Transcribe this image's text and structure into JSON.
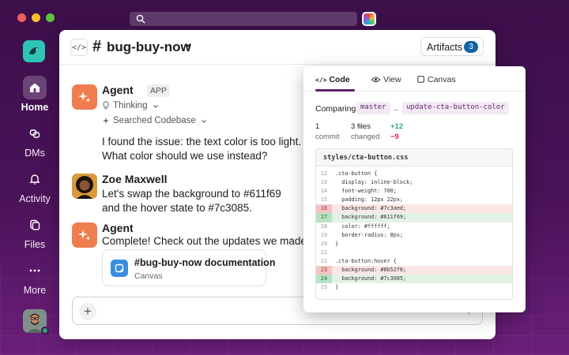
{
  "window": {
    "rail": {
      "items": [
        {
          "label": "Home",
          "icon": "home-icon",
          "active": true
        },
        {
          "label": "DMs",
          "icon": "dms-icon",
          "active": false
        },
        {
          "label": "Activity",
          "icon": "bell-icon",
          "active": false
        },
        {
          "label": "Files",
          "icon": "files-icon",
          "active": false
        },
        {
          "label": "More",
          "icon": "more-icon",
          "active": false
        }
      ]
    }
  },
  "channel": {
    "hash": "#",
    "name": "bug-buy-now",
    "artifacts_label": "Artifacts",
    "artifacts_count": "3"
  },
  "messages": {
    "agent1": {
      "name": "Agent",
      "badge": "APP",
      "thinking": "Thinking",
      "searched": "Searched Codebase",
      "line1": "I found the issue: the text color is too light.",
      "line2": "What color should we use instead?"
    },
    "zoe": {
      "name": "Zoe Maxwell",
      "line1": "Let's swap the background to #611f69",
      "line2": "and the hover state to #7c3085."
    },
    "agent2": {
      "name": "Agent",
      "line1": "Complete! Check out the updates we made:",
      "canvas_title": "#bug-buy-now documentation",
      "canvas_sub": "Canvas"
    }
  },
  "composer": {
    "plus": "+"
  },
  "panel": {
    "tabs": {
      "code": "Code",
      "view": "View",
      "canvas": "Canvas"
    },
    "comparing": "Comparing",
    "base_branch": "master",
    "arrow": "→",
    "head_branch": "update-cta-button-color",
    "stats": {
      "commits": "1",
      "commits_label": "commit",
      "files": "3 files",
      "files_label": "changed",
      "added": "+12",
      "removed": "−9"
    },
    "file_name": "styles/cta-button.css",
    "code": [
      {
        "n": "12",
        "t": ".cta-button {",
        "k": ""
      },
      {
        "n": "13",
        "t": "  display: inline-block;",
        "k": ""
      },
      {
        "n": "14",
        "t": "  font-weight: 700;",
        "k": ""
      },
      {
        "n": "15",
        "t": "  padding: 12px 22px;",
        "k": ""
      },
      {
        "n": "16",
        "t": "  background: #7c3aed;",
        "k": "del"
      },
      {
        "n": "17",
        "t": "  background: #611f69;",
        "k": "add"
      },
      {
        "n": "18",
        "t": "  color: #ffffff;",
        "k": ""
      },
      {
        "n": "19",
        "t": "  border-radius: 8px;",
        "k": ""
      },
      {
        "n": "20",
        "t": "}",
        "k": ""
      },
      {
        "n": "21",
        "t": "",
        "k": ""
      },
      {
        "n": "22",
        "t": ".cta-button:hover {",
        "k": ""
      },
      {
        "n": "23",
        "t": "  background: #8b52f0;",
        "k": "del"
      },
      {
        "n": "24",
        "t": "  background: #7c3085;",
        "k": "add"
      },
      {
        "n": "25",
        "t": "}",
        "k": ""
      }
    ]
  },
  "colors": {
    "aubergine": "#611f69",
    "added": "#2bac76",
    "removed": "#e01e5a",
    "agent_avatar": "#f07d4f"
  }
}
